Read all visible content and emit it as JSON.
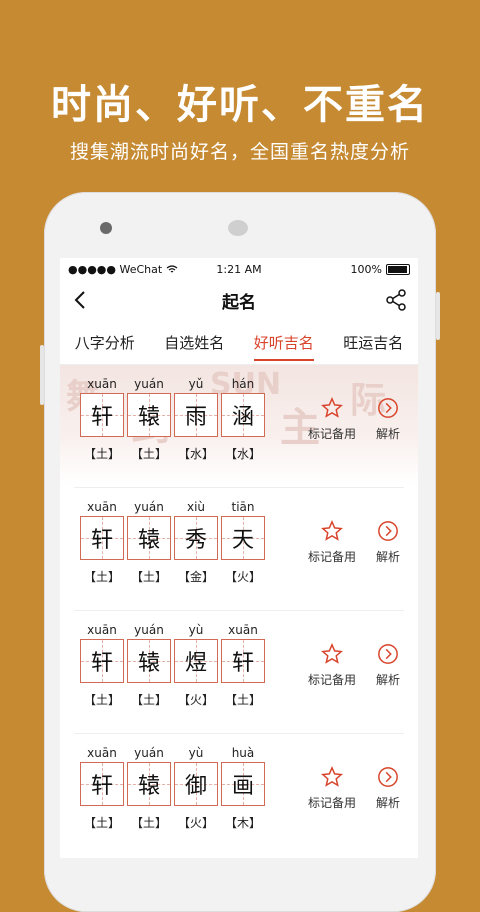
{
  "promo": {
    "headline": "时尚、好听、不重名",
    "subline": "搜集潮流时尚好名，全国重名热度分析"
  },
  "status_bar": {
    "carrier": "●●●●● WeChat",
    "time": "1:21 AM",
    "battery": "100%"
  },
  "navbar": {
    "title": "起名"
  },
  "tabs": [
    {
      "label": "八字分析"
    },
    {
      "label": "自选姓名"
    },
    {
      "label": "好听吉名"
    },
    {
      "label": "旺运吉名"
    }
  ],
  "actions": {
    "mark": "标记备用",
    "analyze": "解析"
  },
  "names": [
    {
      "chars": [
        {
          "py": "xuān",
          "ch": "轩",
          "el": "【土】"
        },
        {
          "py": "yuán",
          "ch": "辕",
          "el": "【土】"
        },
        {
          "py": "yǔ",
          "ch": "雨",
          "el": "【水】"
        },
        {
          "py": "hán",
          "ch": "涵",
          "el": "【水】"
        }
      ]
    },
    {
      "chars": [
        {
          "py": "xuān",
          "ch": "轩",
          "el": "【土】"
        },
        {
          "py": "yuán",
          "ch": "辕",
          "el": "【土】"
        },
        {
          "py": "xiù",
          "ch": "秀",
          "el": "【金】"
        },
        {
          "py": "tiān",
          "ch": "天",
          "el": "【火】"
        }
      ]
    },
    {
      "chars": [
        {
          "py": "xuān",
          "ch": "轩",
          "el": "【土】"
        },
        {
          "py": "yuán",
          "ch": "辕",
          "el": "【土】"
        },
        {
          "py": "yù",
          "ch": "煜",
          "el": "【火】"
        },
        {
          "py": "xuān",
          "ch": "轩",
          "el": "【土】"
        }
      ]
    },
    {
      "chars": [
        {
          "py": "xuān",
          "ch": "轩",
          "el": "【土】"
        },
        {
          "py": "yuán",
          "ch": "辕",
          "el": "【土】"
        },
        {
          "py": "yù",
          "ch": "御",
          "el": "【火】"
        },
        {
          "py": "huà",
          "ch": "画",
          "el": "【木】"
        }
      ]
    }
  ],
  "colors": {
    "background": "#C68A32",
    "accent": "#d8432a"
  }
}
